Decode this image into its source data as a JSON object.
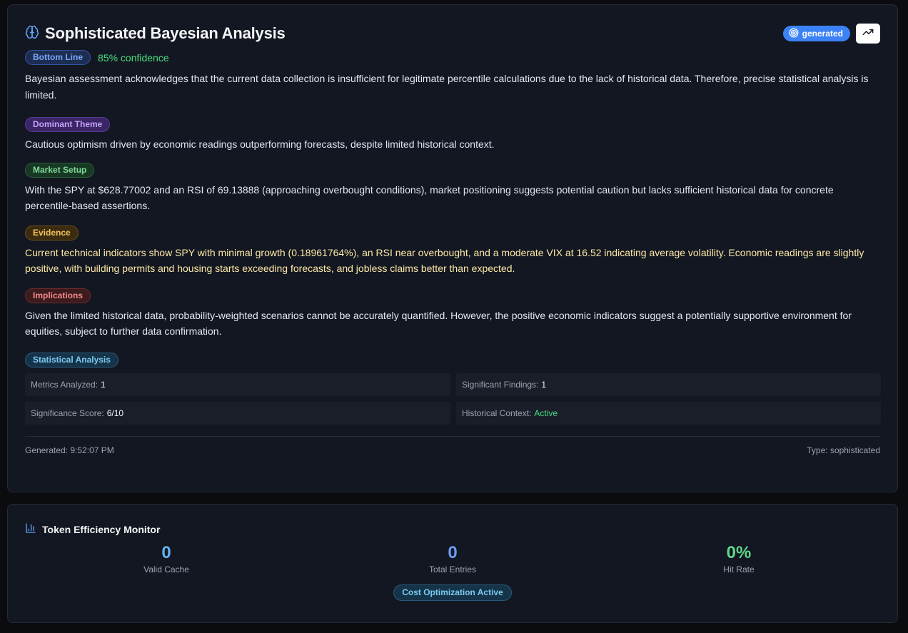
{
  "analysis": {
    "title": "Sophisticated Bayesian Analysis",
    "status_badge": "generated",
    "bottom_line": {
      "label": "Bottom Line",
      "confidence": "85% confidence",
      "text": "Bayesian assessment acknowledges that the current data collection is insufficient for legitimate percentile calculations due to the lack of historical data. Therefore, precise statistical analysis is limited."
    },
    "dominant_theme": {
      "label": "Dominant Theme",
      "text": "Cautious optimism driven by economic readings outperforming forecasts, despite limited historical context."
    },
    "market_setup": {
      "label": "Market Setup",
      "text": "With the SPY at $628.77002 and an RSI of 69.13888 (approaching overbought conditions), market positioning suggests potential caution but lacks sufficient historical data for concrete percentile-based assertions."
    },
    "evidence": {
      "label": "Evidence",
      "text": "Current technical indicators show SPY with minimal growth (0.18961764%), an RSI near overbought, and a moderate VIX at 16.52 indicating average volatility. Economic readings are slightly positive, with building permits and housing starts exceeding forecasts, and jobless claims better than expected."
    },
    "implications": {
      "label": "Implications",
      "text": "Given the limited historical data, probability-weighted scenarios cannot be accurately quantified. However, the positive economic indicators suggest a potentially supportive environment for equities, subject to further data confirmation."
    },
    "statistical": {
      "label": "Statistical Analysis",
      "metrics_analyzed_label": "Metrics Analyzed:",
      "metrics_analyzed_value": "1",
      "significant_findings_label": "Significant Findings:",
      "significant_findings_value": "1",
      "significance_score_label": "Significance Score:",
      "significance_score_value": "6/10",
      "historical_context_label": "Historical Context:",
      "historical_context_value": "Active"
    },
    "footer": {
      "generated": "Generated: 9:52:07 PM",
      "type": "Type: sophisticated"
    }
  },
  "token_monitor": {
    "title": "Token Efficiency Monitor",
    "metrics": [
      {
        "value": "0",
        "label": "Valid Cache",
        "color": "#60b5f0"
      },
      {
        "value": "0",
        "label": "Total Entries",
        "color": "#6b9cf5"
      },
      {
        "value": "0%",
        "label": "Hit Rate",
        "color": "#5fd68a"
      }
    ],
    "badge": "Cost Optimization Active"
  },
  "colors": {
    "accent_blue": "#3b82f6",
    "confidence_green": "#4ade80"
  }
}
